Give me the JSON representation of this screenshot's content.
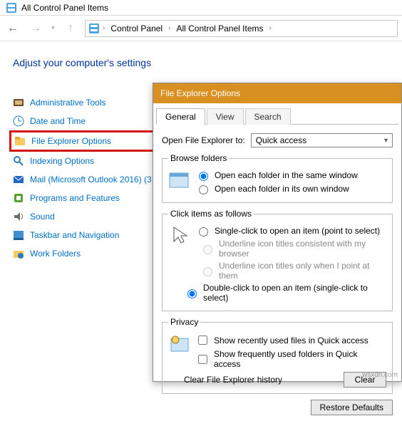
{
  "window": {
    "title": "All Control Panel Items"
  },
  "breadcrumb": {
    "seg1": "Control Panel",
    "seg2": "All Control Panel Items"
  },
  "heading": "Adjust your computer's settings",
  "items": {
    "admin": "Administrative Tools",
    "date": "Date and Time",
    "feo": "File Explorer Options",
    "index": "Indexing Options",
    "mail": "Mail (Microsoft Outlook 2016) (3",
    "prog": "Programs and Features",
    "sound": "Sound",
    "taskbar": "Taskbar and Navigation",
    "work": "Work Folders"
  },
  "dialog": {
    "title": "File Explorer Options",
    "tabs": {
      "general": "General",
      "view": "View",
      "search": "Search"
    },
    "open_to_label": "Open File Explorer to:",
    "open_to_value": "Quick access",
    "browse": {
      "legend": "Browse folders",
      "same": "Open each folder in the same window",
      "own": "Open each folder in its own window"
    },
    "click": {
      "legend": "Click items as follows",
      "single": "Single-click to open an item (point to select)",
      "u1": "Underline icon titles consistent with my browser",
      "u2": "Underline icon titles only when I point at them",
      "double": "Double-click to open an item (single-click to select)"
    },
    "privacy": {
      "legend": "Privacy",
      "recent": "Show recently used files in Quick access",
      "freq": "Show frequently used folders in Quick access",
      "clear_label": "Clear File Explorer history",
      "clear_btn": "Clear"
    },
    "restore": "Restore Defaults"
  },
  "watermark": "wsxdn.com"
}
